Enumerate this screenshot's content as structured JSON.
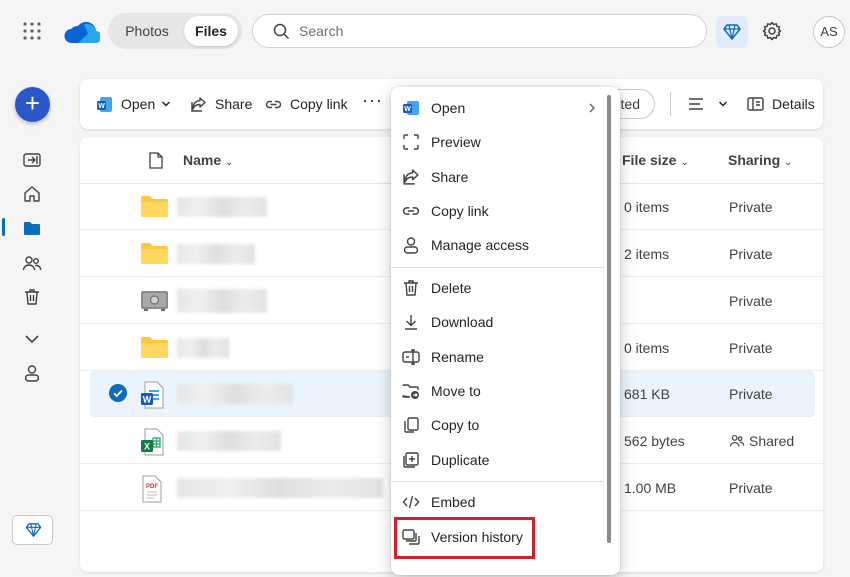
{
  "topbar": {
    "tabs": [
      {
        "label": "Photos"
      },
      {
        "label": "Files"
      }
    ],
    "search_placeholder": "Search",
    "avatar_initials": "AS"
  },
  "toolbar": {
    "open_label": "Open",
    "share_label": "Share",
    "copy_link_label": "Copy link",
    "more_label": "···",
    "sort_label_partial": "ted",
    "details_label": "Details"
  },
  "list": {
    "columns": {
      "name": "Name",
      "size": "File size",
      "sharing": "Sharing"
    },
    "rows": [
      {
        "type": "folder",
        "size": "0 items",
        "sharing": "Private",
        "selected": false
      },
      {
        "type": "folder",
        "size": "2 items",
        "sharing": "Private",
        "selected": false
      },
      {
        "type": "vault",
        "size": "",
        "sharing": "Private",
        "selected": false
      },
      {
        "type": "folder",
        "size": "0 items",
        "sharing": "Private",
        "selected": false
      },
      {
        "type": "word",
        "size": "681 KB",
        "sharing": "Private",
        "selected": true
      },
      {
        "type": "excel",
        "size": "562 bytes",
        "sharing": "Shared",
        "selected": false
      },
      {
        "type": "pdf",
        "size": "1.00 MB",
        "sharing": "Private",
        "selected": false
      }
    ]
  },
  "context_menu": {
    "items": [
      {
        "label": "Open",
        "icon": "word-icon",
        "submenu": true
      },
      {
        "label": "Preview",
        "icon": "preview-icon"
      },
      {
        "label": "Share",
        "icon": "share-icon"
      },
      {
        "label": "Copy link",
        "icon": "link-icon"
      },
      {
        "label": "Manage access",
        "icon": "person-icon"
      },
      {
        "label": "Delete",
        "icon": "trash-icon"
      },
      {
        "label": "Download",
        "icon": "download-icon"
      },
      {
        "label": "Rename",
        "icon": "rename-icon"
      },
      {
        "label": "Move to",
        "icon": "move-icon"
      },
      {
        "label": "Copy to",
        "icon": "copy-icon"
      },
      {
        "label": "Duplicate",
        "icon": "duplicate-icon"
      },
      {
        "label": "Embed",
        "icon": "embed-icon"
      },
      {
        "label": "Version history",
        "icon": "version-history-icon",
        "highlighted": true
      }
    ]
  },
  "colors": {
    "accent": "#0f6cbd",
    "fab": "#2b57c9",
    "folder": "#ffc83d",
    "highlight_box": "#d0202c",
    "selected_row": "#ebf3fc"
  }
}
